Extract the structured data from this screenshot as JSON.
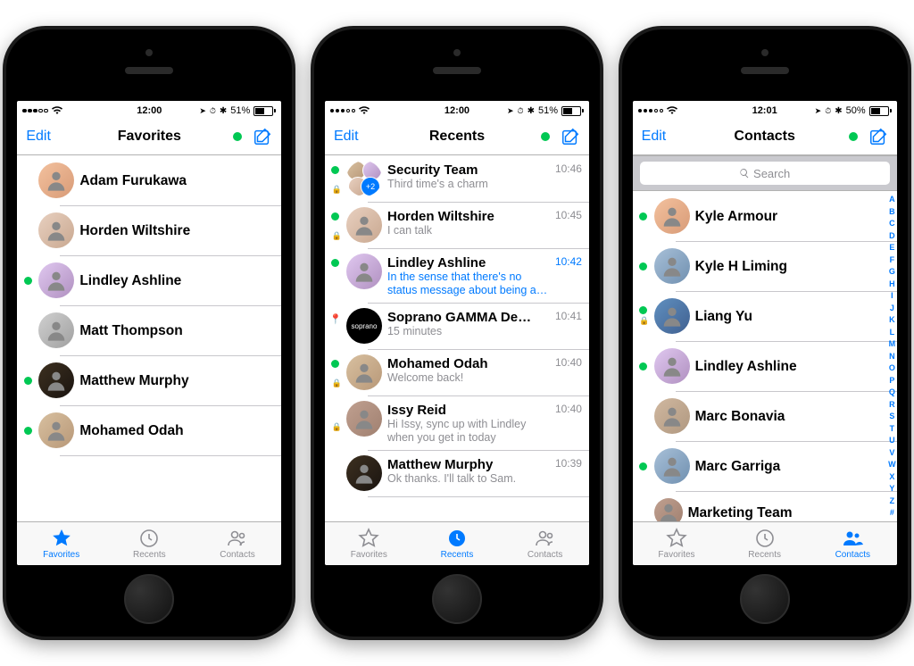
{
  "phones": [
    {
      "status_time": "12:00",
      "battery_pct": "51%",
      "nav_edit": "Edit",
      "nav_title": "Favorites",
      "tabs": {
        "favorites": "Favorites",
        "recents": "Recents",
        "contacts": "Contacts"
      },
      "items": [
        {
          "name": "Adam Furukawa",
          "online": false
        },
        {
          "name": "Horden Wiltshire",
          "online": false
        },
        {
          "name": "Lindley Ashline",
          "online": true
        },
        {
          "name": "Matt Thompson",
          "online": false
        },
        {
          "name": "Matthew Murphy",
          "online": true
        },
        {
          "name": "Mohamed Odah",
          "online": true
        }
      ]
    },
    {
      "status_time": "12:00",
      "battery_pct": "51%",
      "nav_edit": "Edit",
      "nav_title": "Recents",
      "tabs": {
        "favorites": "Favorites",
        "recents": "Recents",
        "contacts": "Contacts"
      },
      "group_badge": "+2",
      "items": [
        {
          "name": "Security Team",
          "sub": "Third time's a charm",
          "time": "10:46",
          "online": true,
          "lock": true,
          "group": true
        },
        {
          "name": "Horden Wiltshire",
          "sub": "I can talk",
          "time": "10:45",
          "online": true,
          "lock": true
        },
        {
          "name": "Lindley Ashline",
          "sub": "In the sense that there's no status message about being a…",
          "time": "10:42",
          "online": true,
          "unread": true
        },
        {
          "name": "Soprano GAMMA De…",
          "sub": "15 minutes",
          "time": "10:41",
          "loc": true,
          "dark": true,
          "brand": "soprano"
        },
        {
          "name": "Mohamed Odah",
          "sub": "Welcome back!",
          "time": "10:40",
          "online": true,
          "lock": true
        },
        {
          "name": "Issy Reid",
          "sub": "Hi Issy, sync up with Lindley when you get in today",
          "time": "10:40",
          "lock": true
        },
        {
          "name": "Matthew Murphy",
          "sub": "Ok thanks. I'll talk to Sam.",
          "time": "10:39"
        }
      ]
    },
    {
      "status_time": "12:01",
      "battery_pct": "50%",
      "nav_edit": "Edit",
      "nav_title": "Contacts",
      "search_placeholder": "Search",
      "tabs": {
        "favorites": "Favorites",
        "recents": "Recents",
        "contacts": "Contacts"
      },
      "index": "ABCDEFGHIJKLMNOPQRSTUVWXYZ#",
      "items": [
        {
          "name": "Kyle Armour",
          "online": true
        },
        {
          "name": "Kyle H Liming",
          "online": true
        },
        {
          "name": "Liang Yu",
          "online": true,
          "lock": true
        },
        {
          "name": "Lindley Ashline",
          "online": true
        },
        {
          "name": "Marc Bonavia"
        },
        {
          "name": "Marc Garriga",
          "online": true
        },
        {
          "name": "Marketing Team"
        }
      ]
    }
  ]
}
